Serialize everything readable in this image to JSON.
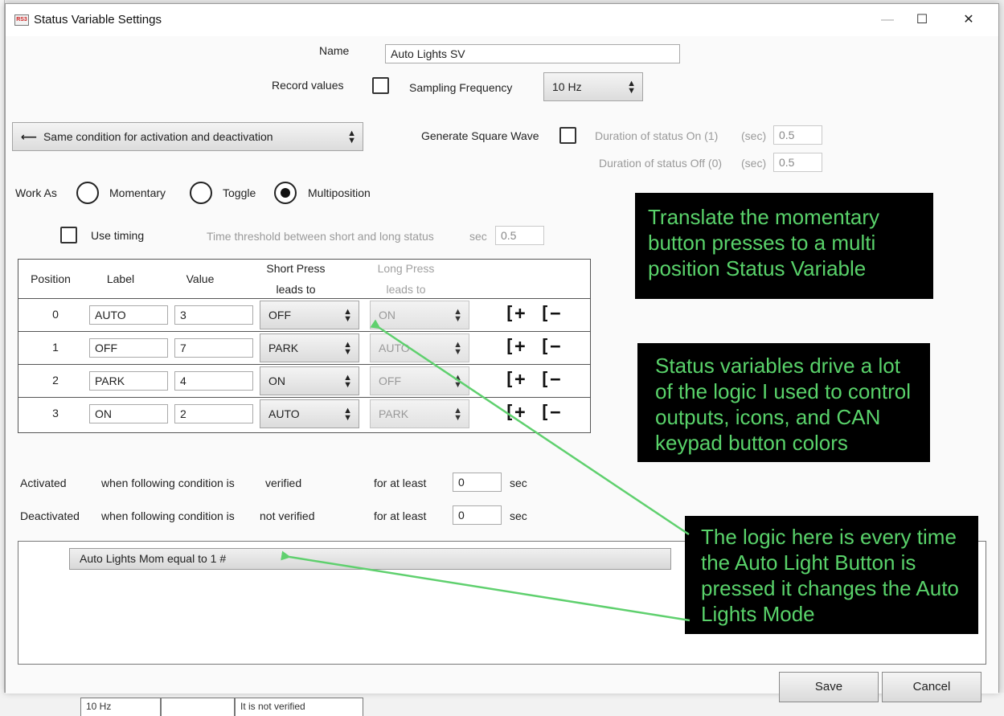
{
  "window": {
    "title": "Status Variable Settings",
    "app_icon_text": "RS3",
    "minimize_glyph": "—",
    "maximize_glyph": "☐",
    "close_glyph": "✕"
  },
  "form": {
    "name_label": "Name",
    "name_value": "Auto Lights SV",
    "record_label": "Record values",
    "record_checked": false,
    "sampling_label": "Sampling Frequency",
    "sampling_value": "10 Hz",
    "mode_combo": "Same condition for activation and deactivation",
    "mode_icon": "⟵",
    "square_wave_label": "Generate Square Wave",
    "square_wave_checked": false,
    "duration_on_label": "Duration of status On (1)",
    "duration_off_label": "Duration of status Off (0)",
    "sec_unit_paren": "(sec)",
    "duration_on_value": "0.5",
    "duration_off_value": "0.5",
    "work_as_label": "Work As",
    "work_as_options": [
      "Momentary",
      "Toggle",
      "Multiposition"
    ],
    "work_as_selected": "Multiposition",
    "use_timing_label": "Use timing",
    "use_timing_checked": false,
    "threshold_label": "Time threshold between short and long status",
    "threshold_unit": "sec",
    "threshold_value": "0.5"
  },
  "table": {
    "headers": {
      "position": "Position",
      "label": "Label",
      "value": "Value",
      "short_press_1": "Short Press",
      "short_press_2": "leads to",
      "long_press_1": "Long Press",
      "long_press_2": "leads to"
    },
    "rows": [
      {
        "position": "0",
        "label": "AUTO",
        "value": "3",
        "short": "OFF",
        "long": "ON"
      },
      {
        "position": "1",
        "label": "OFF",
        "value": "7",
        "short": "PARK",
        "long": "AUTO"
      },
      {
        "position": "2",
        "label": "PARK",
        "value": "4",
        "short": "ON",
        "long": "OFF"
      },
      {
        "position": "3",
        "label": "ON",
        "value": "2",
        "short": "AUTO",
        "long": "PARK"
      }
    ],
    "add_glyph": "[+",
    "remove_glyph": "[−"
  },
  "conditions": {
    "activated_label": "Activated",
    "deactivated_label": "Deactivated",
    "when_text": "when following condition is",
    "verified": "verified",
    "not_verified": "not verified",
    "for_at_least": "for at least",
    "activated_value": "0",
    "deactivated_value": "0",
    "sec": "sec",
    "condition_text": "Auto Lights Mom   equal to    1 #"
  },
  "buttons": {
    "save": "Save",
    "cancel": "Cancel"
  },
  "background_app": {
    "cell1": "10 Hz",
    "cell3": "It is   not verified"
  },
  "annotations": {
    "note1": "Translate the momentary button presses to a multi position Status Variable",
    "note2": "Status variables drive a lot of the logic I used to control outputs, icons, and CAN keypad button colors",
    "note3": "The logic here is every time the Auto Light Button is pressed it changes the Auto Lights Mode",
    "text_color": "#59d26a",
    "arrow_color": "#5fd06e"
  }
}
